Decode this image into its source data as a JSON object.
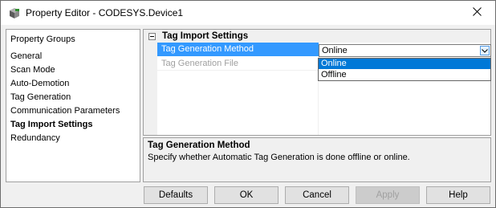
{
  "window": {
    "title": "Property Editor - CODESYS.Device1"
  },
  "left_panel": {
    "header": "Property Groups",
    "items": [
      {
        "label": "General"
      },
      {
        "label": "Scan Mode"
      },
      {
        "label": "Auto-Demotion"
      },
      {
        "label": "Tag Generation"
      },
      {
        "label": "Communication Parameters"
      },
      {
        "label": "Tag Import Settings",
        "selected": true
      },
      {
        "label": "Redundancy"
      }
    ]
  },
  "grid": {
    "category": "Tag Import Settings",
    "properties": [
      {
        "name": "Tag Generation Method",
        "value": "Online",
        "selected": true
      },
      {
        "name": "Tag Generation File",
        "value": "",
        "disabled": true
      }
    ],
    "dropdown_options": [
      "Online",
      "Offline"
    ],
    "dropdown_highlighted": "Online"
  },
  "description": {
    "title": "Tag Generation Method",
    "text": "Specify whether Automatic Tag Generation is done offline or online."
  },
  "buttons": {
    "defaults": "Defaults",
    "ok": "OK",
    "cancel": "Cancel",
    "apply": "Apply",
    "help": "Help"
  },
  "colors": {
    "selection": "#3399ff",
    "dropdown_highlight": "#0078d7"
  },
  "icons": {
    "app": "codesys-app-icon",
    "close": "close-icon",
    "expander": "collapse-icon",
    "combo": "chevron-down-icon"
  }
}
